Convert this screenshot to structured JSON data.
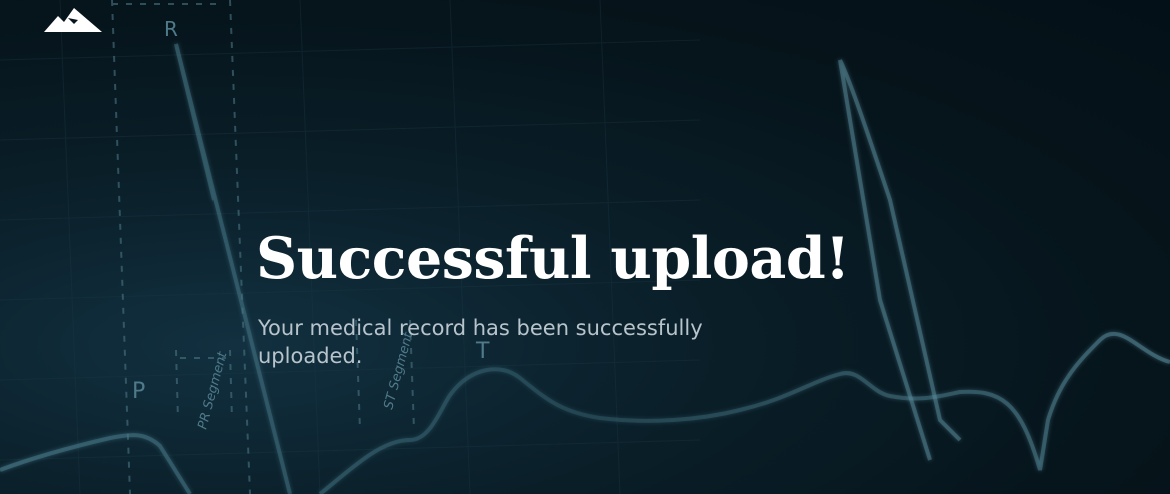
{
  "brand": {
    "logo_icon": "mountain-logo-icon"
  },
  "hero": {
    "title": "Successful upload!",
    "subtitle": "Your medical record has been successfully uploaded."
  },
  "ecg_labels": {
    "r": "R",
    "p": "P",
    "t": "T",
    "pr_segment": "PR Segment",
    "st_segment": "ST Segment"
  },
  "colors": {
    "background": "#06141b",
    "trace": "#3f6e7e",
    "title": "#ffffff",
    "subtitle": "#b8c4cb"
  }
}
